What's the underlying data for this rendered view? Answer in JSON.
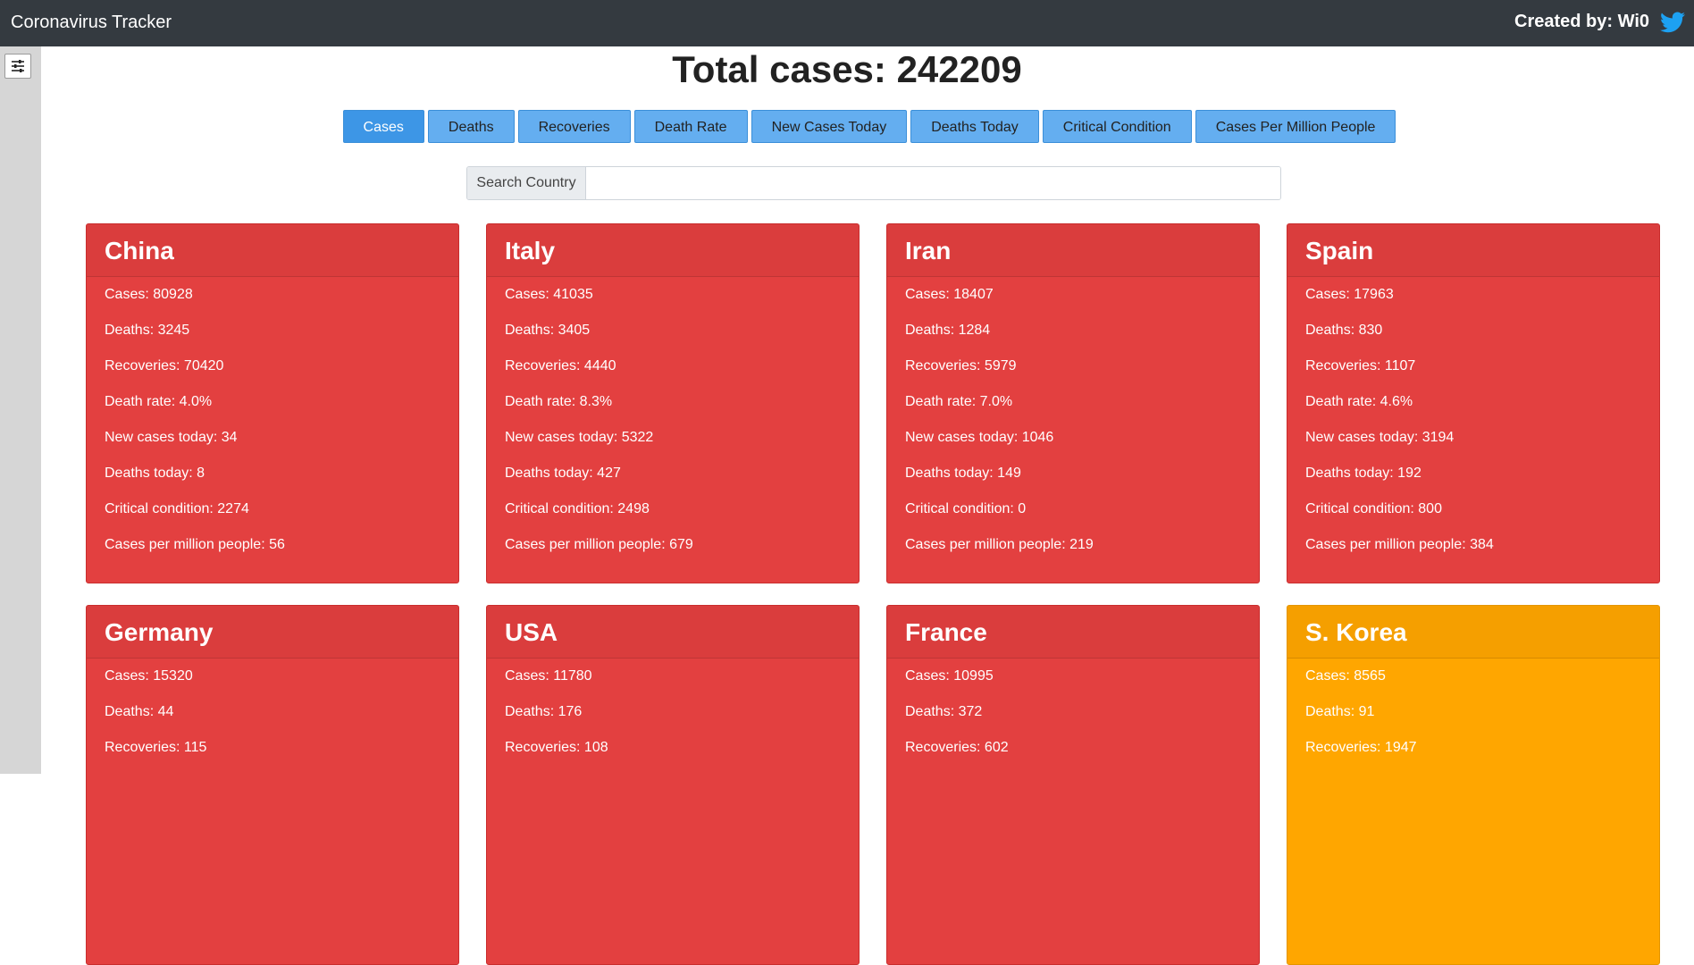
{
  "app": {
    "title": "Coronavirus Tracker",
    "credit": "Created by: Wi0"
  },
  "summary": {
    "total_label": "Total cases: 242209"
  },
  "sort_buttons": [
    {
      "label": "Cases",
      "active": true
    },
    {
      "label": "Deaths",
      "active": false
    },
    {
      "label": "Recoveries",
      "active": false
    },
    {
      "label": "Death Rate",
      "active": false
    },
    {
      "label": "New Cases Today",
      "active": false
    },
    {
      "label": "Deaths Today",
      "active": false
    },
    {
      "label": "Critical Condition",
      "active": false
    },
    {
      "label": "Cases Per Million People",
      "active": false
    }
  ],
  "search": {
    "label": "Search Country",
    "value": ""
  },
  "colors": {
    "navbar": "#343a40",
    "card_red": "#e34040",
    "card_orange": "#ffa600",
    "button": "#64aef0",
    "button_active": "#3d96e6",
    "twitter": "#1da1f2"
  },
  "countries": [
    {
      "name": "China",
      "color": "red",
      "stats": [
        "Cases: 80928",
        "Deaths: 3245",
        "Recoveries: 70420",
        "Death rate: 4.0%",
        "New cases today: 34",
        "Deaths today: 8",
        "Critical condition: 2274",
        "Cases per million people: 56"
      ]
    },
    {
      "name": "Italy",
      "color": "red",
      "stats": [
        "Cases: 41035",
        "Deaths: 3405",
        "Recoveries: 4440",
        "Death rate: 8.3%",
        "New cases today: 5322",
        "Deaths today: 427",
        "Critical condition: 2498",
        "Cases per million people: 679"
      ]
    },
    {
      "name": "Iran",
      "color": "red",
      "stats": [
        "Cases: 18407",
        "Deaths: 1284",
        "Recoveries: 5979",
        "Death rate: 7.0%",
        "New cases today: 1046",
        "Deaths today: 149",
        "Critical condition: 0",
        "Cases per million people: 219"
      ]
    },
    {
      "name": "Spain",
      "color": "red",
      "stats": [
        "Cases: 17963",
        "Deaths: 830",
        "Recoveries: 1107",
        "Death rate: 4.6%",
        "New cases today: 3194",
        "Deaths today: 192",
        "Critical condition: 800",
        "Cases per million people: 384"
      ]
    },
    {
      "name": "Germany",
      "color": "red",
      "stats": [
        "Cases: 15320",
        "Deaths: 44",
        "Recoveries: 115"
      ]
    },
    {
      "name": "USA",
      "color": "red",
      "stats": [
        "Cases: 11780",
        "Deaths: 176",
        "Recoveries: 108"
      ]
    },
    {
      "name": "France",
      "color": "red",
      "stats": [
        "Cases: 10995",
        "Deaths: 372",
        "Recoveries: 602"
      ]
    },
    {
      "name": "S. Korea",
      "color": "orange",
      "stats": [
        "Cases: 8565",
        "Deaths: 91",
        "Recoveries: 1947"
      ]
    }
  ]
}
